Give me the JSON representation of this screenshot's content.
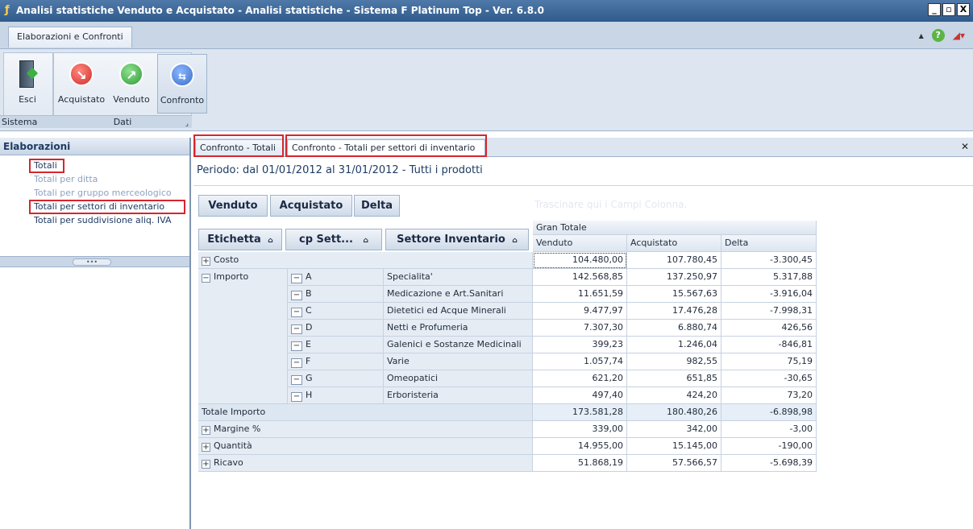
{
  "window": {
    "title": "Analisi statistiche Venduto e Acquistato - Analisi statistiche - Sistema F Platinum Top - Ver. 6.8.0",
    "controls": [
      "_",
      "̅□",
      "X"
    ]
  },
  "ribbon": {
    "tab": "Elaborazioni e Confronti",
    "buttons": {
      "esci": "Esci",
      "acquistato": "Acquistato",
      "venduto": "Venduto",
      "confronto": "Confronto"
    },
    "groups": {
      "sistema": "Sistema",
      "dati": "Dati"
    }
  },
  "left_panel": {
    "title": "Elaborazioni",
    "items": [
      "Totali",
      "Totali per ditta",
      "Totali per gruppo merceologico",
      "Totali per settori di inventario",
      "Totali per suddivisione aliq. IVA"
    ],
    "splitter_grip": "•••"
  },
  "doc_tabs": [
    "Confronto - Totali",
    "Confronto - Totali per settori di inventario"
  ],
  "period": "Periodo: dal 01/01/2012 al 31/01/2012 - Tutti i prodotti",
  "data_fields": [
    "Venduto",
    "Acquistato",
    "Delta"
  ],
  "column_drop_hint": "Trascinare qui i Campi Colonna.",
  "row_fields": [
    "Etichetta",
    "cp Sett...",
    "Settore Inventario"
  ],
  "grand_total_header": "Gran Totale",
  "value_headers": [
    "Venduto",
    "Acquistato",
    "Delta"
  ],
  "rows": {
    "costo": {
      "label": "Costo",
      "values": [
        "104.480,00",
        "107.780,45",
        "-3.300,45"
      ]
    },
    "importo_label": "Importo",
    "importo_rows": [
      {
        "code": "A",
        "settore": "Specialita'",
        "values": [
          "142.568,85",
          "137.250,97",
          "5.317,88"
        ]
      },
      {
        "code": "B",
        "settore": "Medicazione e Art.Sanitari",
        "values": [
          "11.651,59",
          "15.567,63",
          "-3.916,04"
        ]
      },
      {
        "code": "C",
        "settore": "Dietetici ed Acque Minerali",
        "values": [
          "9.477,97",
          "17.476,28",
          "-7.998,31"
        ]
      },
      {
        "code": "D",
        "settore": "Netti e Profumeria",
        "values": [
          "7.307,30",
          "6.880,74",
          "426,56"
        ]
      },
      {
        "code": "E",
        "settore": "Galenici e Sostanze Medicinali",
        "values": [
          "399,23",
          "1.246,04",
          "-846,81"
        ]
      },
      {
        "code": "F",
        "settore": "Varie",
        "values": [
          "1.057,74",
          "982,55",
          "75,19"
        ]
      },
      {
        "code": "G",
        "settore": "Omeopatici",
        "values": [
          "621,20",
          "651,85",
          "-30,65"
        ]
      },
      {
        "code": "H",
        "settore": "Erboristeria",
        "values": [
          "497,40",
          "424,20",
          "73,20"
        ]
      }
    ],
    "totale_importo": {
      "label": "Totale Importo",
      "values": [
        "173.581,28",
        "180.480,26",
        "-6.898,98"
      ]
    },
    "margine": {
      "label": "Margine %",
      "values": [
        "339,00",
        "342,00",
        "-3,00"
      ]
    },
    "quantita": {
      "label": "Quantità",
      "values": [
        "14.955,00",
        "15.145,00",
        "-190,00"
      ]
    },
    "ricavo": {
      "label": "Ricavo",
      "values": [
        "51.868,19",
        "57.566,57",
        "-5.698,39"
      ]
    }
  },
  "colors": {
    "highlight": "#d6262e",
    "titlebar": "#2f5a8c"
  }
}
